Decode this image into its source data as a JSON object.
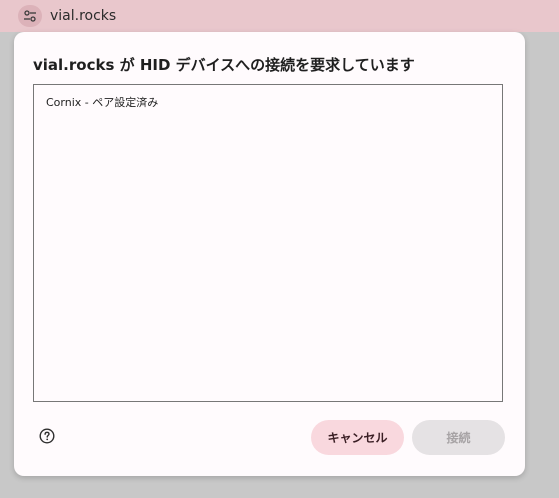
{
  "browser": {
    "origin": "vial.rocks",
    "site_info_icon": "tune-icon"
  },
  "dialog": {
    "title": "vial.rocks が HID デバイスへの接続を要求しています",
    "devices": [
      {
        "label": "Cornix - ペア設定済み"
      }
    ],
    "help_icon": "help-circle-icon",
    "cancel_label": "キャンセル",
    "connect_label": "接続",
    "connect_enabled": false
  },
  "colors": {
    "topbar": "#e9c7cc",
    "dialog_bg": "#fffbfd",
    "cancel_bg": "#f9d8de",
    "connect_bg_disabled": "#e5e2e4"
  }
}
